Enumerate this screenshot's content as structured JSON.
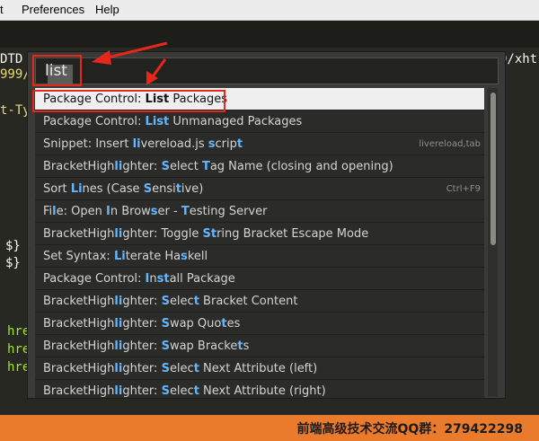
{
  "menu": [
    "t",
    "Preferences",
    "Help"
  ],
  "code_lines": [
    "DTD X",
    "999/",
    "t-Ty",
    "$}",
    "$}",
    "hre",
    "hre",
    "hre",
    "D/xht"
  ],
  "palette": {
    "query": "list",
    "results": [
      {
        "segments": [
          [
            "Package Control: ",
            false
          ],
          [
            "List",
            true
          ],
          [
            " Packages",
            false
          ]
        ],
        "shortcut": "",
        "selected": true
      },
      {
        "segments": [
          [
            "Package Control: ",
            false
          ],
          [
            "List",
            true
          ],
          [
            " Unmanaged Packages",
            false
          ]
        ],
        "shortcut": "",
        "selected": false
      },
      {
        "segments": [
          [
            "Snippet: Insert ",
            false
          ],
          [
            "li",
            true
          ],
          [
            "vereload.js ",
            false
          ],
          [
            "s",
            true
          ],
          [
            "crip",
            false
          ],
          [
            "t",
            true
          ]
        ],
        "shortcut": "livereload,tab",
        "selected": false
      },
      {
        "segments": [
          [
            "BracketHigh",
            false
          ],
          [
            "li",
            true
          ],
          [
            "ghter: ",
            false
          ],
          [
            "S",
            true
          ],
          [
            "elect ",
            false
          ],
          [
            "T",
            true
          ],
          [
            "ag Name (closing and opening)",
            false
          ]
        ],
        "shortcut": "",
        "selected": false
      },
      {
        "segments": [
          [
            "Sort ",
            false
          ],
          [
            "Li",
            true
          ],
          [
            "nes (Case ",
            false
          ],
          [
            "S",
            true
          ],
          [
            "ensi",
            false
          ],
          [
            "t",
            true
          ],
          [
            "ive)",
            false
          ]
        ],
        "shortcut": "Ctrl+F9",
        "selected": false
      },
      {
        "segments": [
          [
            "Fi",
            false
          ],
          [
            "l",
            true
          ],
          [
            "e: Open ",
            false
          ],
          [
            "I",
            true
          ],
          [
            "n Brow",
            false
          ],
          [
            "s",
            true
          ],
          [
            "er - ",
            false
          ],
          [
            "T",
            true
          ],
          [
            "esting Server",
            false
          ]
        ],
        "shortcut": "",
        "selected": false
      },
      {
        "segments": [
          [
            "BracketHigh",
            false
          ],
          [
            "li",
            true
          ],
          [
            "ghter: Toggle ",
            false
          ],
          [
            "St",
            true
          ],
          [
            "ring Bracket Escape Mode",
            false
          ]
        ],
        "shortcut": "",
        "selected": false
      },
      {
        "segments": [
          [
            "Set Syntax: ",
            false
          ],
          [
            "Li",
            true
          ],
          [
            "terate Ha",
            false
          ],
          [
            "s",
            true
          ],
          [
            "kell",
            false
          ]
        ],
        "shortcut": "",
        "selected": false
      },
      {
        "segments": [
          [
            "Package Control: ",
            false
          ],
          [
            "I",
            true
          ],
          [
            "n",
            false
          ],
          [
            "st",
            true
          ],
          [
            "all Package",
            false
          ]
        ],
        "shortcut": "",
        "selected": false
      },
      {
        "segments": [
          [
            "BracketHigh",
            false
          ],
          [
            "li",
            true
          ],
          [
            "ghter: ",
            false
          ],
          [
            "S",
            true
          ],
          [
            "elec",
            false
          ],
          [
            "t",
            true
          ],
          [
            " Bracket Content",
            false
          ]
        ],
        "shortcut": "",
        "selected": false
      },
      {
        "segments": [
          [
            "BracketHigh",
            false
          ],
          [
            "li",
            true
          ],
          [
            "ghter: ",
            false
          ],
          [
            "S",
            true
          ],
          [
            "wap Quo",
            false
          ],
          [
            "t",
            true
          ],
          [
            "es",
            false
          ]
        ],
        "shortcut": "",
        "selected": false
      },
      {
        "segments": [
          [
            "BracketHigh",
            false
          ],
          [
            "li",
            true
          ],
          [
            "ghter: ",
            false
          ],
          [
            "S",
            true
          ],
          [
            "wap Bracke",
            false
          ],
          [
            "t",
            true
          ],
          [
            "s",
            false
          ]
        ],
        "shortcut": "",
        "selected": false
      },
      {
        "segments": [
          [
            "BracketHigh",
            false
          ],
          [
            "li",
            true
          ],
          [
            "ghter: ",
            false
          ],
          [
            "S",
            true
          ],
          [
            "elec",
            false
          ],
          [
            "t",
            true
          ],
          [
            " Next Attribute (left)",
            false
          ]
        ],
        "shortcut": "",
        "selected": false
      },
      {
        "segments": [
          [
            "BracketHigh",
            false
          ],
          [
            "li",
            true
          ],
          [
            "ghter: ",
            false
          ],
          [
            "S",
            true
          ],
          [
            "elec",
            false
          ],
          [
            "t",
            true
          ],
          [
            " Next Attribute (right)",
            false
          ]
        ],
        "shortcut": "",
        "selected": false
      }
    ]
  },
  "footer": {
    "text": "前端高级技术交流QQ群：279422298"
  },
  "colors": {
    "background": "#272822",
    "highlight": "#63b6ff",
    "annotation": "#e8271b",
    "footer": "#ea7a2c"
  }
}
